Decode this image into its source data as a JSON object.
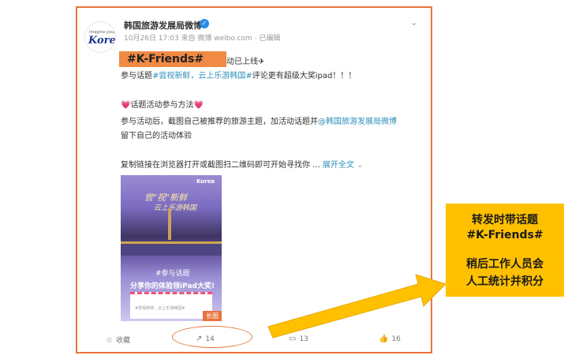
{
  "account": {
    "name": "韩国旅游发展局微博",
    "meta": "10月26日 17:03 来自 微博 weibo.com · 已编辑",
    "avatar_line1": "Imagine your",
    "avatar_line2": "Korea"
  },
  "post": {
    "hashtag_overlay": "#K-Friends#",
    "line1_tail": "动已上线✈",
    "line2_pre": "参与话题",
    "line2_topic": "#尝视新鲜，云上乐游韩国#",
    "line2_post": "评论更有超级大奖ipad！！！",
    "line3": "话题活动参与方法",
    "line4_pre": "参与活动后，截图自己被推荐的旅游主题，加活动话题并",
    "line4_mention": "@韩国旅游发展局微博",
    "line5": "留下自己的活动体验",
    "line6_pre": "复制链接在浏览器打开或截图扫二维码即可开始寻找你 ...",
    "expand": "展开全文"
  },
  "image": {
    "title1": "尝\"视\"新鲜",
    "title2": "云上乐游韩国",
    "tag1": "#参与话题",
    "tag2": "分享你的体验领iPad大奖!",
    "card": "#尝视新鲜，云上乐游韩国#",
    "corner": "Korea",
    "long_label": "长图"
  },
  "actions": {
    "favorite": "收藏",
    "repost_count": "14",
    "comment_count": "13",
    "like_count": "16"
  },
  "callout": {
    "line1": "转发时带话题",
    "line2": "#K-Friends#",
    "line3": "稍后工作人员会",
    "line4": "人工统计并积分"
  },
  "colors": {
    "accent_orange": "#e8743b",
    "highlight_orange": "#f08a45",
    "callout_yellow": "#ffc000",
    "link_blue": "#2e8fb8"
  }
}
